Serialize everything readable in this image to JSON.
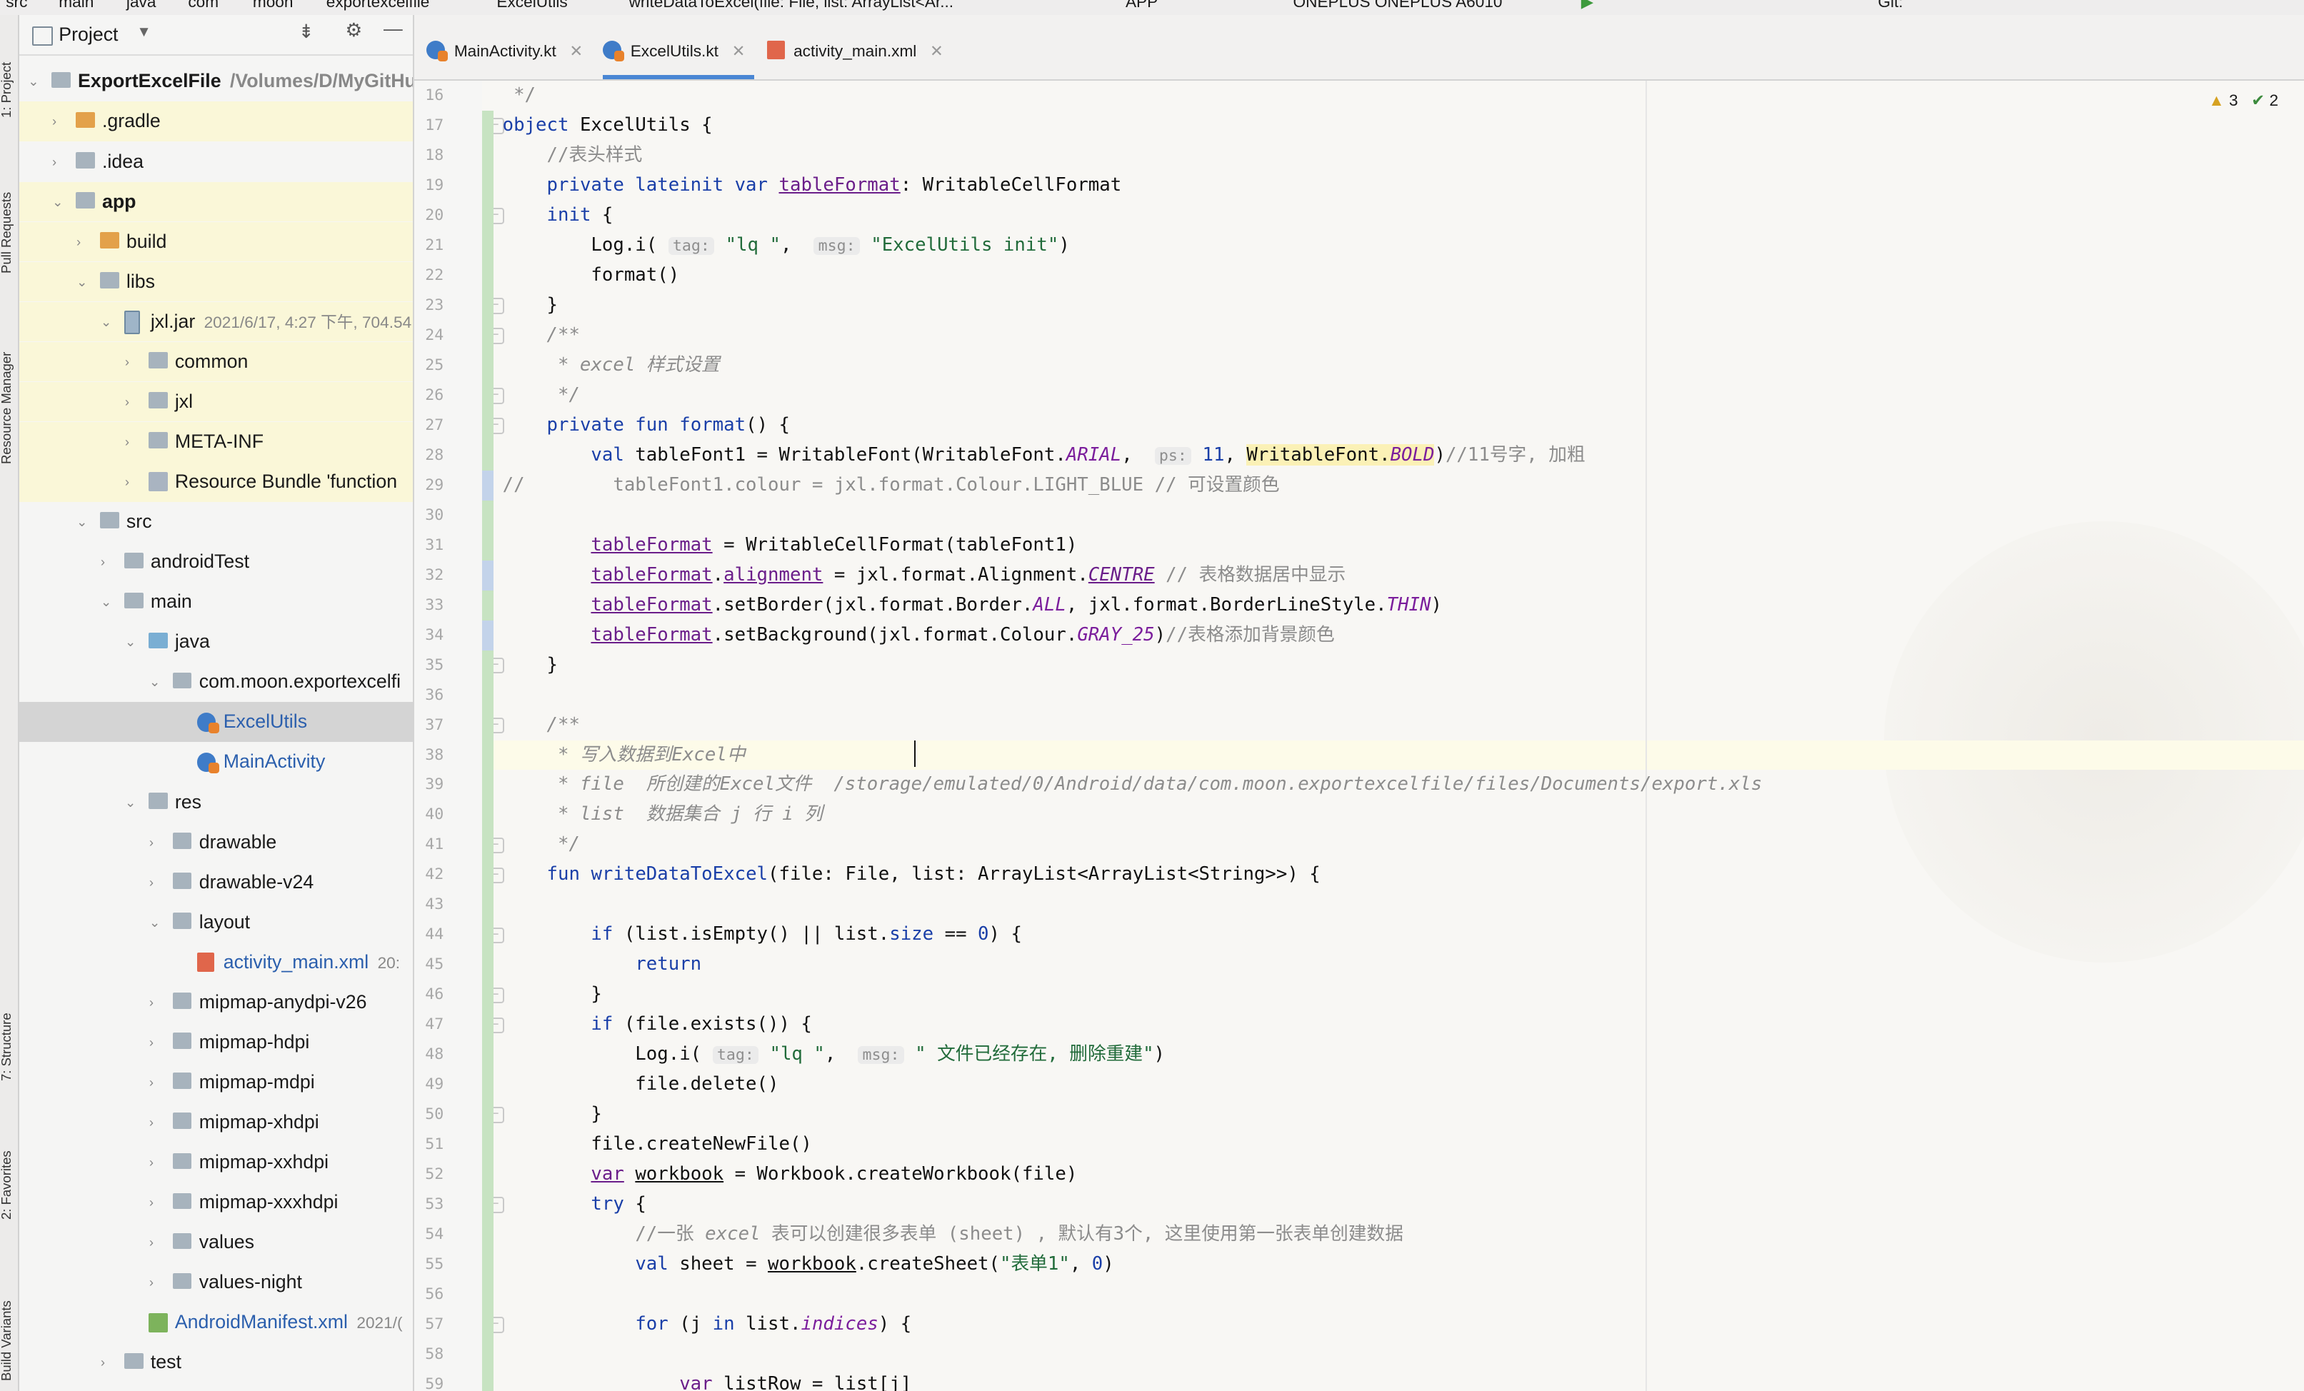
{
  "breadcrumb": {
    "items": [
      "src",
      "main",
      "java",
      "com",
      "moon",
      "exportexcelfile",
      "ExcelUtils",
      "writeDataToExcel(file: File, list: ArrayList<Ar..."
    ],
    "run_config": "APP",
    "device": "ONEPLUS ONEPLUS A6010",
    "git_label": "Git:"
  },
  "tool_windows": {
    "project": "1: Project",
    "pull_requests": "Pull Requests",
    "resource_manager": "Resource Manager",
    "structure": "7: Structure",
    "favorites": "2: Favorites",
    "build_variants": "Build Variants"
  },
  "project_panel": {
    "title": "Project",
    "root_name": "ExportExcelFile",
    "root_path": "/Volumes/D/MyGitHu",
    "tree": [
      {
        "label": "ExportExcelFile",
        "depth": 0
      },
      {
        "label": ".gradle",
        "depth": 1
      },
      {
        "label": ".idea",
        "depth": 1
      },
      {
        "label": "app",
        "depth": 1
      },
      {
        "label": "build",
        "depth": 2
      },
      {
        "label": "libs",
        "depth": 2
      },
      {
        "label": "jxl.jar",
        "meta": "2021/6/17, 4:27 下午, 704.54",
        "depth": 3
      },
      {
        "label": "common",
        "depth": 4
      },
      {
        "label": "jxl",
        "depth": 4
      },
      {
        "label": "META-INF",
        "depth": 4
      },
      {
        "label": "Resource Bundle 'function",
        "depth": 4
      },
      {
        "label": "src",
        "depth": 2
      },
      {
        "label": "androidTest",
        "depth": 3
      },
      {
        "label": "main",
        "depth": 3
      },
      {
        "label": "java",
        "depth": 4
      },
      {
        "label": "com.moon.exportexcelfi",
        "depth": 5
      },
      {
        "label": "ExcelUtils",
        "depth": 6
      },
      {
        "label": "MainActivity",
        "depth": 6
      },
      {
        "label": "res",
        "depth": 4
      },
      {
        "label": "drawable",
        "depth": 5
      },
      {
        "label": "drawable-v24",
        "depth": 5
      },
      {
        "label": "layout",
        "depth": 5
      },
      {
        "label": "activity_main.xml",
        "meta": "20:",
        "depth": 6
      },
      {
        "label": "mipmap-anydpi-v26",
        "depth": 5
      },
      {
        "label": "mipmap-hdpi",
        "depth": 5
      },
      {
        "label": "mipmap-mdpi",
        "depth": 5
      },
      {
        "label": "mipmap-xhdpi",
        "depth": 5
      },
      {
        "label": "mipmap-xxhdpi",
        "depth": 5
      },
      {
        "label": "mipmap-xxxhdpi",
        "depth": 5
      },
      {
        "label": "values",
        "depth": 5
      },
      {
        "label": "values-night",
        "depth": 5
      },
      {
        "label": "AndroidManifest.xml",
        "meta": "2021/(",
        "depth": 4
      },
      {
        "label": "test",
        "depth": 3
      }
    ]
  },
  "tabs": [
    {
      "label": "MainActivity.kt",
      "active": false
    },
    {
      "label": "ExcelUtils.kt",
      "active": true
    },
    {
      "label": "activity_main.xml",
      "active": false
    }
  ],
  "inspections": {
    "warnings": "3",
    "weak_warnings": "2"
  },
  "code": {
    "line_numbers": [
      "16",
      "17",
      "18",
      "19",
      "20",
      "21",
      "22",
      "23",
      "24",
      "25",
      "26",
      "27",
      "28",
      "29",
      "30",
      "31",
      "32",
      "33",
      "34",
      "35",
      "36",
      "37",
      "38",
      "39",
      "40",
      "41",
      "42",
      "43",
      "44",
      "45",
      "46",
      "47",
      "48",
      "49",
      "50",
      "51",
      "52",
      "53",
      "54",
      "55",
      "56",
      "57",
      "58",
      "59"
    ],
    "lines": [
      [
        [
          "c",
          " */"
        ]
      ],
      [
        [
          "k",
          "object"
        ],
        [
          "t",
          " ExcelUtils {"
        ]
      ],
      [
        [
          "t",
          "    "
        ],
        [
          "c",
          "//表头样式"
        ]
      ],
      [
        [
          "t",
          "    "
        ],
        [
          "k",
          "private lateinit var"
        ],
        [
          "t",
          " "
        ],
        [
          "u",
          "tableFormat"
        ],
        [
          "t",
          ": WritableCellFormat"
        ]
      ],
      [
        [
          "t",
          "    "
        ],
        [
          "k",
          "init"
        ],
        [
          "t",
          " {"
        ]
      ],
      [
        [
          "t",
          "        Log.i( "
        ],
        [
          "h",
          "tag:"
        ],
        [
          "t",
          " "
        ],
        [
          "s",
          "\"lq \""
        ],
        [
          "t",
          ",  "
        ],
        [
          "h",
          "msg:"
        ],
        [
          "t",
          " "
        ],
        [
          "s",
          "\"ExcelUtils init\""
        ],
        [
          "t",
          ")"
        ]
      ],
      [
        [
          "t",
          "        format()"
        ]
      ],
      [
        [
          "t",
          "    }"
        ]
      ],
      [
        [
          "t",
          "    "
        ],
        [
          "ci",
          "/**"
        ]
      ],
      [
        [
          "t",
          "     "
        ],
        [
          "ci",
          "* excel 样式设置"
        ]
      ],
      [
        [
          "t",
          "     "
        ],
        [
          "ci",
          "*/"
        ]
      ],
      [
        [
          "t",
          "    "
        ],
        [
          "k",
          "private fun"
        ],
        [
          "t",
          " "
        ],
        [
          "n",
          "format"
        ],
        [
          "t",
          "() {"
        ]
      ],
      [
        [
          "t",
          "        "
        ],
        [
          "k",
          "val"
        ],
        [
          "t",
          " tableFont1 = WritableFont(WritableFont."
        ],
        [
          "p",
          "ARIAL"
        ],
        [
          "t",
          ",  "
        ],
        [
          "h",
          "ps:"
        ],
        [
          "t",
          " "
        ],
        [
          "n",
          "11"
        ],
        [
          "t",
          ", "
        ],
        [
          "hl",
          "WritableFont."
        ],
        [
          "pb",
          "BOLD"
        ],
        [
          "t",
          ")"
        ],
        [
          "c",
          "//11号字, 加粗"
        ]
      ],
      [
        [
          "c",
          "//        tableFont1.colour = jxl.format.Colour.LIGHT_BLUE // 可设置颜色"
        ]
      ],
      [
        [
          "t",
          ""
        ]
      ],
      [
        [
          "t",
          "        "
        ],
        [
          "u",
          "tableFormat"
        ],
        [
          "t",
          " = WritableCellFormat(tableFont1)"
        ]
      ],
      [
        [
          "t",
          "        "
        ],
        [
          "u",
          "tableFormat"
        ],
        [
          "t",
          "."
        ],
        [
          "u",
          "alignment"
        ],
        [
          "t",
          " = jxl.format.Alignment."
        ],
        [
          "pu",
          "CENTRE"
        ],
        [
          "t",
          " "
        ],
        [
          "c",
          "// 表格数据居中显示"
        ]
      ],
      [
        [
          "t",
          "        "
        ],
        [
          "u",
          "tableFormat"
        ],
        [
          "t",
          ".setBorder(jxl.format.Border."
        ],
        [
          "p",
          "ALL"
        ],
        [
          "t",
          ", jxl.format.BorderLineStyle."
        ],
        [
          "p",
          "THIN"
        ],
        [
          "t",
          ")"
        ]
      ],
      [
        [
          "t",
          "        "
        ],
        [
          "u",
          "tableFormat"
        ],
        [
          "t",
          ".setBackground(jxl.format.Colour."
        ],
        [
          "p",
          "GRAY_25"
        ],
        [
          "t",
          ")"
        ],
        [
          "c",
          "//表格添加背景颜色"
        ]
      ],
      [
        [
          "t",
          "    }"
        ]
      ],
      [
        [
          "t",
          ""
        ]
      ],
      [
        [
          "t",
          "    "
        ],
        [
          "ci",
          "/**"
        ]
      ],
      [
        [
          "t",
          "     "
        ],
        [
          "ci",
          "* 写入数据到Excel中"
        ]
      ],
      [
        [
          "t",
          "     "
        ],
        [
          "ci",
          "* file  所创建的Excel文件  /storage/emulated/0/Android/data/com.moon.exportexcelfile/files/Documents/export.xls"
        ]
      ],
      [
        [
          "t",
          "     "
        ],
        [
          "ci",
          "* list  数据集合 j 行 i 列"
        ]
      ],
      [
        [
          "t",
          "     "
        ],
        [
          "ci",
          "*/"
        ]
      ],
      [
        [
          "t",
          "    "
        ],
        [
          "k",
          "fun"
        ],
        [
          "t",
          " "
        ],
        [
          "n",
          "writeDataToExcel"
        ],
        [
          "t",
          "(file: File, list: ArrayList<ArrayList<String>>) {"
        ]
      ],
      [
        [
          "t",
          ""
        ]
      ],
      [
        [
          "t",
          "        "
        ],
        [
          "k",
          "if"
        ],
        [
          "t",
          " (list.isEmpty() || list."
        ],
        [
          "n",
          "size"
        ],
        [
          "t",
          " == "
        ],
        [
          "n",
          "0"
        ],
        [
          "t",
          ") {"
        ]
      ],
      [
        [
          "t",
          "            "
        ],
        [
          "k",
          "return"
        ]
      ],
      [
        [
          "t",
          "        }"
        ]
      ],
      [
        [
          "t",
          "        "
        ],
        [
          "k",
          "if"
        ],
        [
          "t",
          " (file.exists()) {"
        ]
      ],
      [
        [
          "t",
          "            Log.i( "
        ],
        [
          "h",
          "tag:"
        ],
        [
          "t",
          " "
        ],
        [
          "s",
          "\"lq \""
        ],
        [
          "t",
          ",  "
        ],
        [
          "h",
          "msg:"
        ],
        [
          "t",
          " "
        ],
        [
          "s",
          "\" 文件已经存在, 删除重建\""
        ],
        [
          "t",
          ")"
        ]
      ],
      [
        [
          "t",
          "            file.delete()"
        ]
      ],
      [
        [
          "t",
          "        }"
        ]
      ],
      [
        [
          "t",
          "        file.createNewFile()"
        ]
      ],
      [
        [
          "t",
          "        "
        ],
        [
          "kb",
          "var"
        ],
        [
          "t",
          " "
        ],
        [
          "ub",
          "workbook"
        ],
        [
          "t",
          " = Workbook.createWorkbook(file)"
        ]
      ],
      [
        [
          "t",
          "        "
        ],
        [
          "k",
          "try"
        ],
        [
          "t",
          " {"
        ]
      ],
      [
        [
          "t",
          "            "
        ],
        [
          "c",
          "//一张 "
        ],
        [
          "ci",
          "excel"
        ],
        [
          "c",
          " 表可以创建很多表单 (sheet) , 默认有3个, 这里使用第一张表单创建数据"
        ]
      ],
      [
        [
          "t",
          "            "
        ],
        [
          "k",
          "val"
        ],
        [
          "t",
          " sheet = "
        ],
        [
          "ub",
          "workbook"
        ],
        [
          "t",
          ".createSheet("
        ],
        [
          "s",
          "\"表单1\""
        ],
        [
          "t",
          ", "
        ],
        [
          "n",
          "0"
        ],
        [
          "t",
          ")"
        ]
      ],
      [
        [
          "t",
          ""
        ]
      ],
      [
        [
          "t",
          "            "
        ],
        [
          "k",
          "for"
        ],
        [
          "t",
          " (j "
        ],
        [
          "k",
          "in"
        ],
        [
          "t",
          " list."
        ],
        [
          "p",
          "indices"
        ],
        [
          "t",
          ") {"
        ]
      ],
      [
        [
          "t",
          ""
        ]
      ],
      [
        [
          "t",
          "                "
        ],
        [
          "kb",
          "var"
        ],
        [
          "t",
          " "
        ],
        [
          "ub",
          "listRow"
        ],
        [
          "t",
          " = list[j]"
        ]
      ]
    ]
  },
  "colors": {
    "accent": "#4a87d4",
    "keyword": "#1a3fa8",
    "string": "#216b3a",
    "comment": "#8c8c8c",
    "property": "#7b1e9c",
    "change_marker": "#c7e3c2",
    "modify_marker": "#c3d3ea"
  }
}
